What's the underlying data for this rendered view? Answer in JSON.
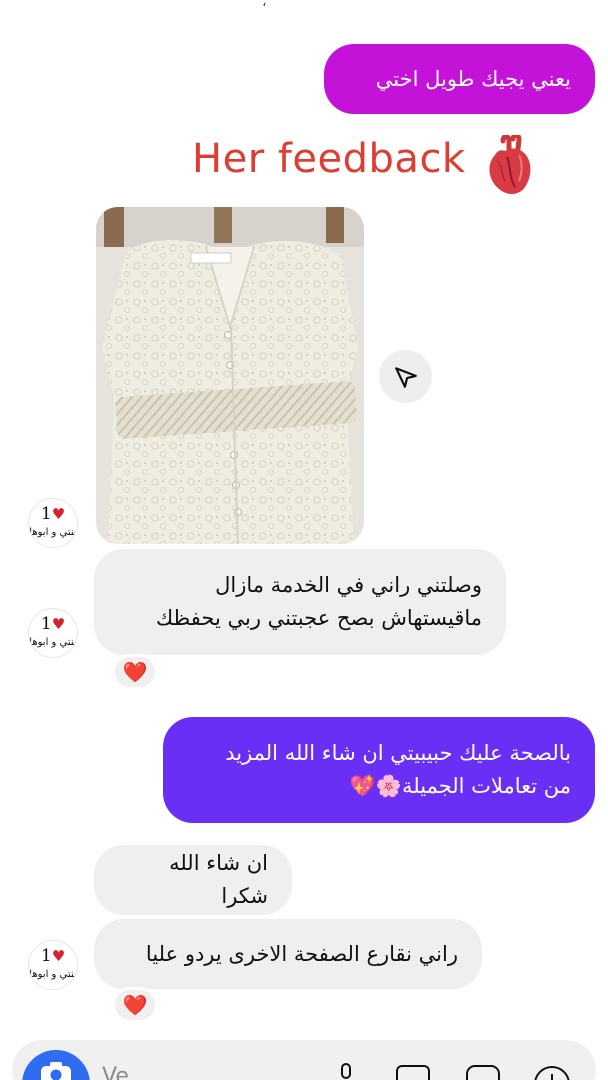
{
  "top_fragment": "،",
  "messages": {
    "m1": {
      "text": "يعني يجيك طويل اختي"
    },
    "feedback_title": "Her feedback",
    "m3": {
      "line1": "وصلتني راني في الخدمة مازال",
      "line2": "ماقيستهاش بصح عجبتني ربي يحفظك"
    },
    "m4": {
      "line1": "بالصحة عليك حبيبيتي ان شاء الله المزيد",
      "line2": "من تعاملات الجميلة🌸💖"
    },
    "m5": {
      "text": "ان شاء الله شكرا"
    },
    "m6": {
      "text": "راني نقارع الصفحة الاخرى يردو عليا"
    }
  },
  "avatar": {
    "top": "1",
    "bottom": "بنتي و ابوها"
  },
  "reactions": [
    "❤️",
    "❤️"
  ],
  "composer": {
    "placeholder": "Ve"
  },
  "colors": {
    "outgoing_pink": "#c512d9",
    "outgoing_purple": "#6a2ff5",
    "incoming": "#efefef",
    "feedback_title": "#de3e31",
    "camera": "#2f6cf0"
  },
  "icons": [
    "share-icon",
    "heart-icon",
    "camera-icon",
    "microphone-icon",
    "gallery-icon",
    "sticker-icon",
    "plus-icon"
  ]
}
